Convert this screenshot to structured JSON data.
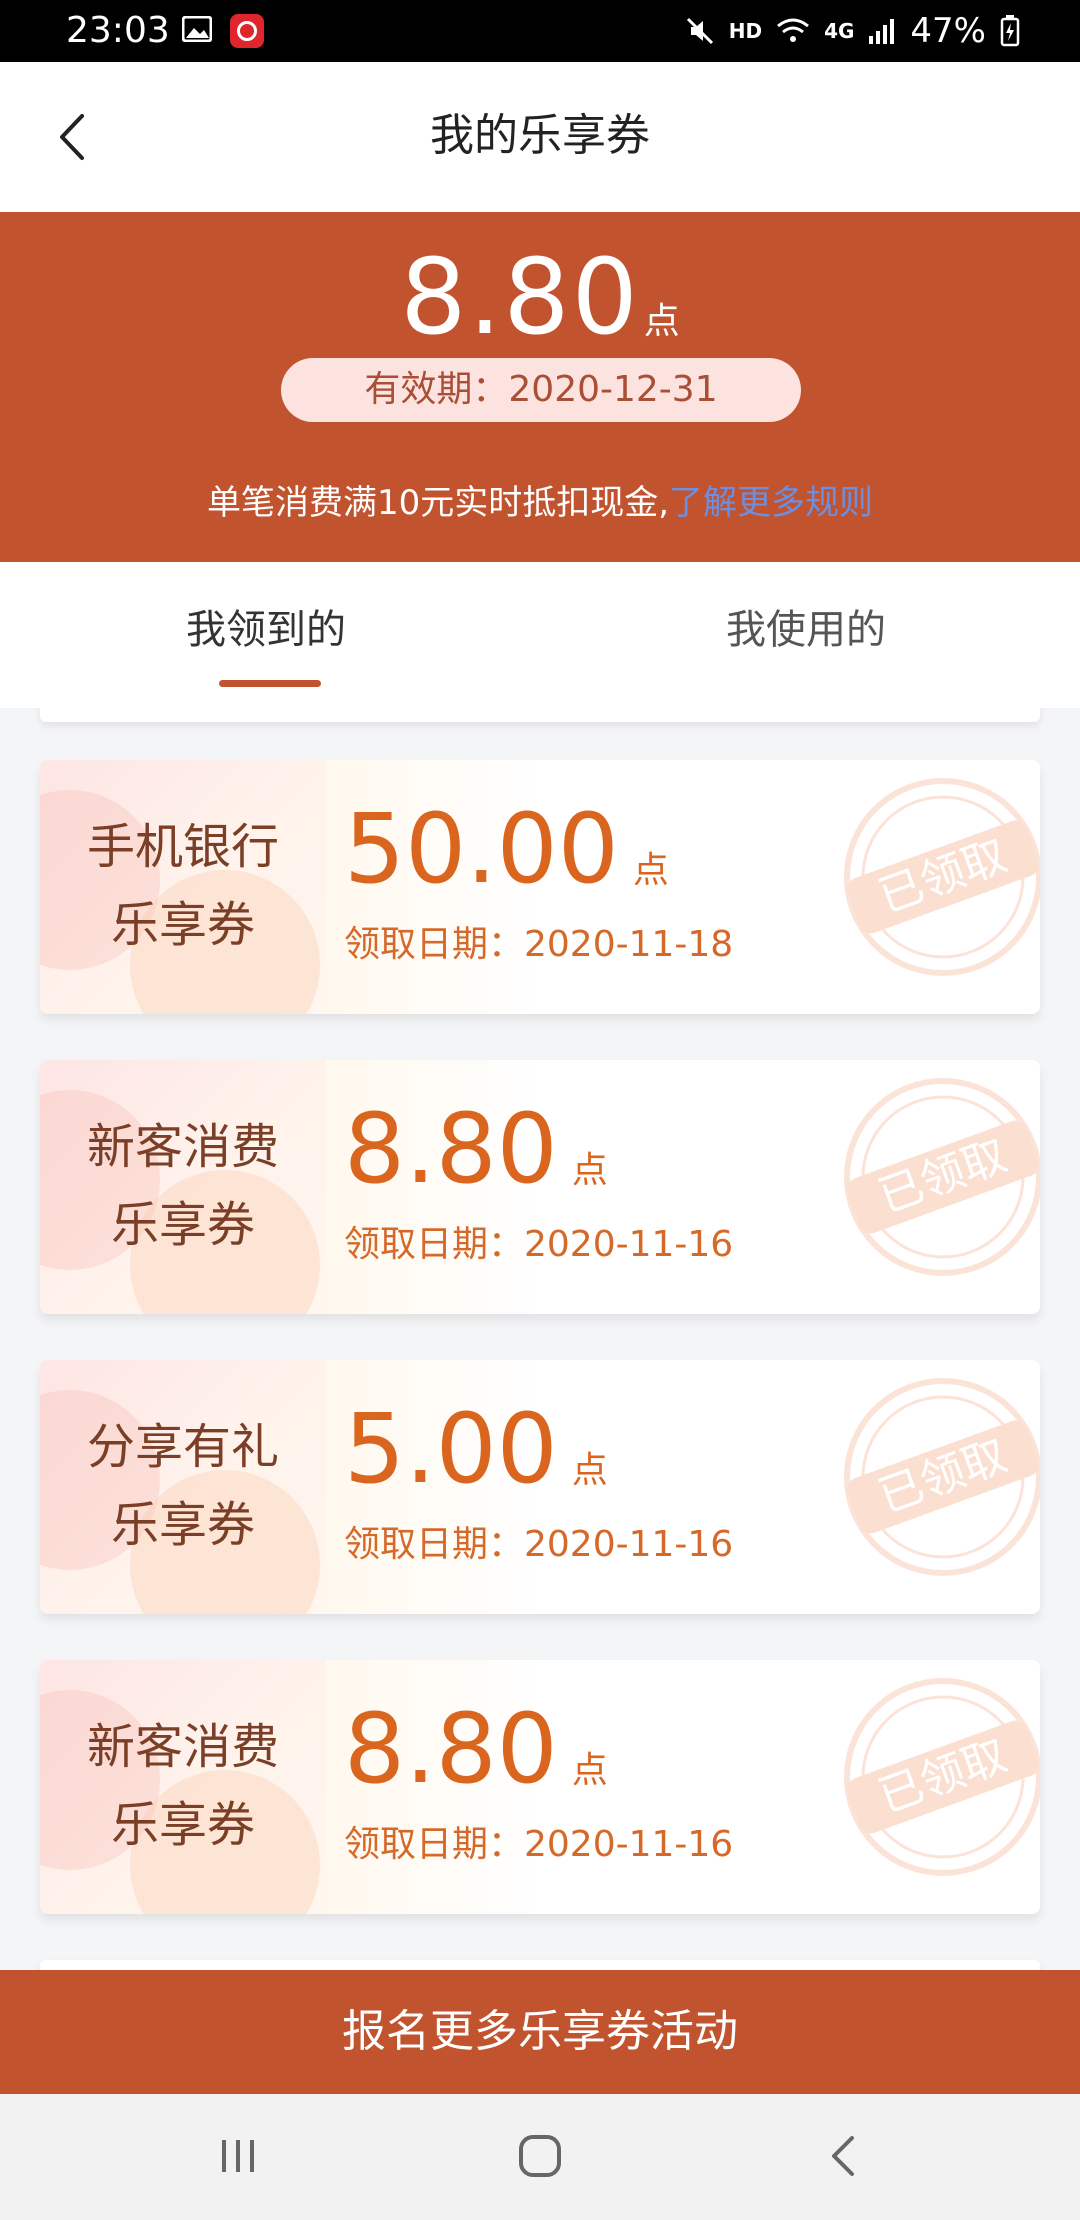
{
  "status_bar": {
    "time": "23:03",
    "hd_label": "HD",
    "network": "4G",
    "battery": "47%"
  },
  "header": {
    "title": "我的乐享券",
    "back_icon": "chevron-left-icon"
  },
  "summary": {
    "balance": "8.80",
    "balance_unit": "点",
    "validity": "有效期：2020-12-31",
    "rule_text": "单笔消费满10元实时抵扣现金,",
    "rule_link": "了解更多规则"
  },
  "tabs": {
    "received": "我领到的",
    "used": "我使用的",
    "active": "received"
  },
  "coupons": [
    {
      "name_line1": "手机银行",
      "name_line2": "乐享券",
      "amount": "50.00",
      "unit": "点",
      "date": "领取日期：2020-11-18",
      "stamp": "已领取"
    },
    {
      "name_line1": "新客消费",
      "name_line2": "乐享券",
      "amount": "8.80",
      "unit": "点",
      "date": "领取日期：2020-11-16",
      "stamp": "已领取"
    },
    {
      "name_line1": "分享有礼",
      "name_line2": "乐享券",
      "amount": "5.00",
      "unit": "点",
      "date": "领取日期：2020-11-16",
      "stamp": "已领取"
    },
    {
      "name_line1": "新客消费",
      "name_line2": "乐享券",
      "amount": "8.80",
      "unit": "点",
      "date": "领取日期：2020-11-16",
      "stamp": "已领取"
    }
  ],
  "bottom_action": {
    "label": "报名更多乐享券活动"
  },
  "colors": {
    "brand": "#c1532f",
    "amount": "#d9651f",
    "link": "#6d8fe0"
  }
}
